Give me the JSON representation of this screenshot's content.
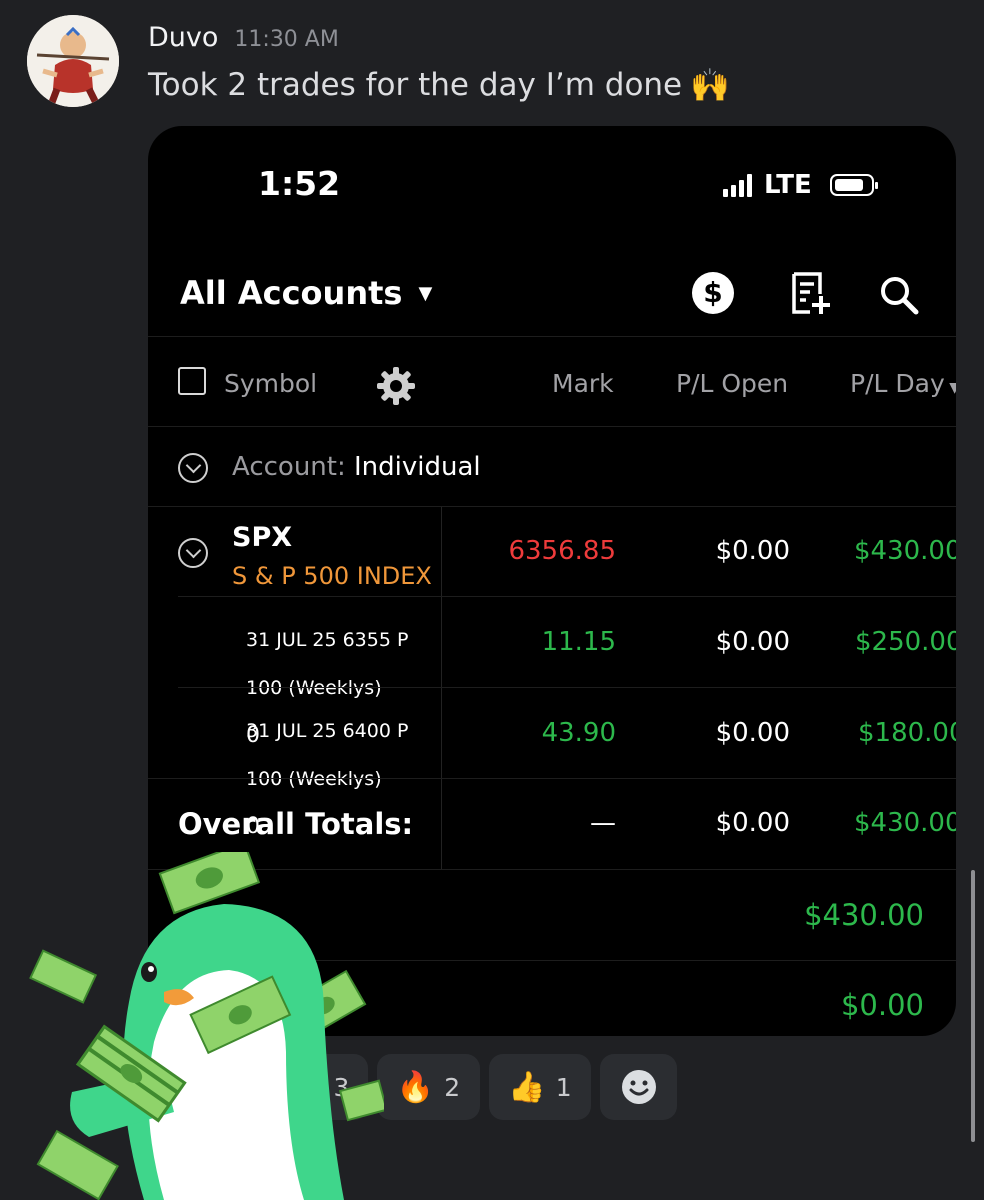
{
  "message": {
    "username": "Duvo",
    "timestamp": "11:30 AM",
    "text": "Took 2 trades for the day I’m done",
    "emoji": "🙌"
  },
  "phone": {
    "status_time": "1:52",
    "network": "LTE",
    "account_selector": "All Accounts",
    "icons": [
      "dollar-circle-icon",
      "trade-ticket-icon",
      "search-icon"
    ],
    "columns": {
      "symbol": "Symbol",
      "mark": "Mark",
      "pl_open": "P/L Open",
      "pl_day": "P/L Day"
    },
    "account_label": "Account: ",
    "account_value": "Individual",
    "position": {
      "symbol": "SPX",
      "description": "S & P 500 INDEX",
      "mark": "6356.85",
      "pl_open": "$0.00",
      "pl_day": "$430.00"
    },
    "legs": [
      {
        "line1": "31 JUL 25 6355 P",
        "line2": "100 (Weeklys)",
        "line3": "0",
        "mark": "11.15",
        "pl_open": "$0.00",
        "pl_day": "$250.00"
      },
      {
        "line1": "31 JUL 25 6400 P",
        "line2": "100 (Weeklys)",
        "line3": "0",
        "mark": "43.90",
        "pl_open": "$0.00",
        "pl_day": "$180.00"
      }
    ],
    "totals": {
      "label": "Overall Totals:",
      "mark": "—",
      "pl_open": "$0.00",
      "pl_day": "$430.00"
    },
    "summary_values": [
      "$430.00",
      "$0.00"
    ]
  },
  "reactions": [
    {
      "emoji": "🌹",
      "count": "3"
    },
    {
      "emoji": "🔥",
      "count": "2"
    },
    {
      "emoji": "👍",
      "count": "1"
    },
    {
      "emoji": "add-reaction-icon",
      "count": ""
    }
  ],
  "colors": {
    "loss": "#ee3b3b",
    "gain": "#2db84c",
    "description": "#f0973a",
    "background": "#1f2023"
  }
}
